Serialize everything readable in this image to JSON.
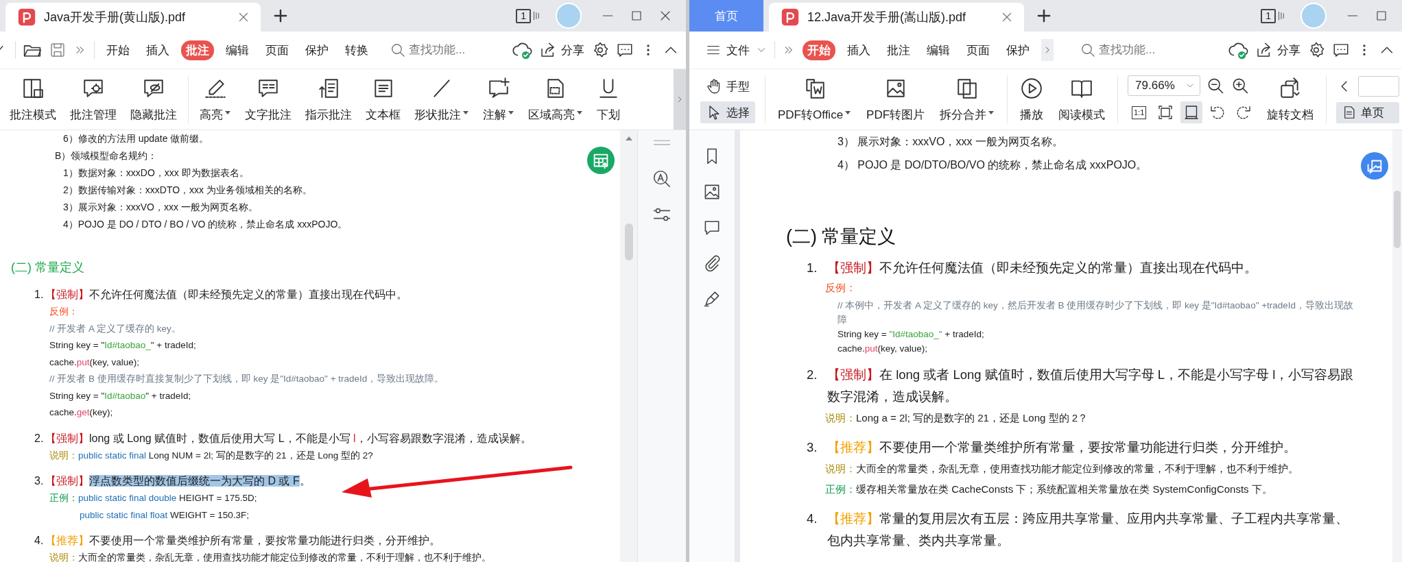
{
  "left_window": {
    "tab": {
      "title": "Java开发手册(黄山版).pdf",
      "selected": true
    },
    "tab_count": "1",
    "menu": {
      "tabs": [
        {
          "label": "开始",
          "selected": false
        },
        {
          "label": "插入",
          "selected": false
        },
        {
          "label": "批注",
          "selected": true
        },
        {
          "label": "编辑",
          "selected": false
        },
        {
          "label": "页面",
          "selected": false
        },
        {
          "label": "保护",
          "selected": false
        },
        {
          "label": "转换",
          "selected": false
        }
      ],
      "search": {
        "placeholder": "查找功能..."
      },
      "share": "分享"
    },
    "toolbar": [
      {
        "label": "批注模式",
        "dropdown": false
      },
      {
        "label": "批注管理",
        "dropdown": false
      },
      {
        "label": "隐藏批注",
        "dropdown": false
      },
      {
        "label": "高亮",
        "dropdown": true
      },
      {
        "label": "文字批注",
        "dropdown": false
      },
      {
        "label": "指示批注",
        "dropdown": false
      },
      {
        "label": "文本框",
        "dropdown": false
      },
      {
        "label": "形状批注",
        "dropdown": true
      },
      {
        "label": "注解",
        "dropdown": true
      },
      {
        "label": "区域高亮",
        "dropdown": true
      },
      {
        "label": "下划",
        "dropdown": false
      }
    ],
    "document": {
      "lines": [
        {
          "kind": "sub_item",
          "segments": [
            {
              "kind": "plain",
              "text": "6）修改的方法用 update 做前缀。"
            }
          ]
        },
        {
          "kind": "sub_heading",
          "segments": [
            {
              "kind": "plain",
              "text": "B）领域模型命名规约："
            }
          ]
        },
        {
          "kind": "sub_item",
          "segments": [
            {
              "kind": "plain",
              "text": "1）数据对象：xxxDO，xxx 即为数据表名。"
            }
          ]
        },
        {
          "kind": "sub_item",
          "segments": [
            {
              "kind": "plain",
              "text": "2）数据传输对象：xxxDTO，xxx 为业务领域相关的名称。"
            }
          ]
        },
        {
          "kind": "sub_item",
          "segments": [
            {
              "kind": "plain",
              "text": "3）展示对象：xxxVO，xxx 一般为网页名称。"
            }
          ]
        },
        {
          "kind": "sub_item",
          "segments": [
            {
              "kind": "plain",
              "text": "4）POJO 是 DO / DTO / BO / VO 的统称，禁止命名成 xxxPOJO。"
            }
          ]
        },
        {
          "kind": "heading",
          "segments": [
            {
              "kind": "plain",
              "text": "(二) 常量定义"
            }
          ]
        },
        {
          "kind": "item",
          "number": "1.",
          "segments": [
            {
              "kind": "mandatory",
              "text": "【强制】"
            },
            {
              "kind": "plain",
              "text": "不允许任何魔法值（即未经预先定义的常量）直接出现在代码中。"
            }
          ]
        },
        {
          "kind": "detail",
          "segments": [
            {
              "kind": "counter_label",
              "text": "反例："
            }
          ]
        },
        {
          "kind": "detail",
          "segments": [
            {
              "kind": "comment",
              "text": "//  开发者 A 定义了缓存的 key。"
            }
          ]
        },
        {
          "kind": "detail",
          "segments": [
            {
              "kind": "plain",
              "text": "String key = \""
            },
            {
              "kind": "string",
              "text": "Id#taobao_"
            },
            {
              "kind": "plain",
              "text": "\" + tradeId;"
            }
          ]
        },
        {
          "kind": "detail",
          "segments": [
            {
              "kind": "plain",
              "text": "cache."
            },
            {
              "kind": "method",
              "text": "put"
            },
            {
              "kind": "plain",
              "text": "(key, value);"
            }
          ]
        },
        {
          "kind": "detail",
          "segments": [
            {
              "kind": "comment",
              "text": "// 开发者 B 使用缓存时直接复制少了下划线，即 key 是\"Id#taobao\" + tradeId，导致出现故障。"
            }
          ]
        },
        {
          "kind": "detail",
          "segments": [
            {
              "kind": "plain",
              "text": "String key = \""
            },
            {
              "kind": "string",
              "text": "Id#taobao"
            },
            {
              "kind": "plain",
              "text": "\" + tradeId;"
            }
          ]
        },
        {
          "kind": "detail",
          "segments": [
            {
              "kind": "plain",
              "text": "cache."
            },
            {
              "kind": "method",
              "text": "get"
            },
            {
              "kind": "plain",
              "text": "(key);"
            }
          ]
        },
        {
          "kind": "item",
          "number": "2.",
          "segments": [
            {
              "kind": "mandatory",
              "text": "【强制】"
            },
            {
              "kind": "plain",
              "text": "long 或 Long 赋值时，数值后使用大写 L，不能是小写 "
            },
            {
              "kind": "alert",
              "text": "l"
            },
            {
              "kind": "plain",
              "text": "，小写容易跟数字混淆，造成误解。"
            }
          ]
        },
        {
          "kind": "detail",
          "segments": [
            {
              "kind": "note_label",
              "text": "说明："
            },
            {
              "kind": "keyword",
              "text": "public static final"
            },
            {
              "kind": "plain",
              "text": " Long NUM = 2l; 写的是数字的 21，还是 Long 型的 2?"
            }
          ]
        },
        {
          "kind": "item",
          "number": "3.",
          "segments": [
            {
              "kind": "mandatory",
              "text": "【强制】"
            },
            {
              "kind": "highlight",
              "text": "浮点数类型的数值后缀统一为大写的 D 或 F"
            },
            {
              "kind": "plain",
              "text": "。"
            }
          ]
        },
        {
          "kind": "detail",
          "segments": [
            {
              "kind": "example_label",
              "text": "正例："
            },
            {
              "kind": "keyword",
              "text": "public static final double"
            },
            {
              "kind": "plain",
              "text": " HEIGHT = 175.5D;"
            }
          ]
        },
        {
          "kind": "detail_indent",
          "segments": [
            {
              "kind": "keyword",
              "text": "public static final float"
            },
            {
              "kind": "plain",
              "text": " WEIGHT = 150.3F;"
            }
          ]
        },
        {
          "kind": "item",
          "number": "4.",
          "segments": [
            {
              "kind": "recommended",
              "text": "【推荐】"
            },
            {
              "kind": "plain",
              "text": "不要使用一个常量类维护所有常量，要按常量功能进行归类，分开维护。"
            }
          ]
        },
        {
          "kind": "detail",
          "segments": [
            {
              "kind": "note_label",
              "text": "说明："
            },
            {
              "kind": "plain",
              "text": "大而全的常量类，杂乱无章，使用查找功能才能定位到修改的常量，不利于理解，也不利于维护。"
            }
          ]
        }
      ]
    }
  },
  "right_window": {
    "home_tab": "首页",
    "tab": {
      "title": "12.Java开发手册(嵩山版).pdf",
      "selected": true
    },
    "tab_count": "1",
    "menu": {
      "file": "文件",
      "tabs": [
        {
          "label": "开始",
          "selected": true
        },
        {
          "label": "插入",
          "selected": false
        },
        {
          "label": "批注",
          "selected": false
        },
        {
          "label": "编辑",
          "selected": false
        },
        {
          "label": "页面",
          "selected": false
        },
        {
          "label": "保护",
          "selected": false
        }
      ],
      "search": {
        "placeholder": "查找功能..."
      },
      "share": "分享"
    },
    "toolbar": {
      "modes": [
        {
          "label": "手型",
          "selected": false
        },
        {
          "label": "选择",
          "selected": true
        }
      ],
      "tools": [
        {
          "label": "PDF转Office",
          "dropdown": true
        },
        {
          "label": "PDF转图片",
          "dropdown": false
        },
        {
          "label": "拆分合并",
          "dropdown": true
        },
        {
          "label": "播放",
          "dropdown": false
        },
        {
          "label": "阅读模式",
          "dropdown": false
        }
      ],
      "zoom": "79.66%",
      "fit_tools": [
        {
          "kind": "actual_size",
          "label": "1:1",
          "selected": false
        },
        {
          "kind": "fit_page",
          "selected": false
        },
        {
          "kind": "fit_width",
          "selected": true
        },
        {
          "kind": "rotate_left",
          "selected": false
        },
        {
          "kind": "rotate_right",
          "selected": false
        }
      ],
      "rotate": "旋转文档",
      "view_mode": {
        "label": "单页",
        "selected": true
      }
    },
    "document": {
      "lines": [
        {
          "kind": "sub_item",
          "segments": [
            {
              "kind": "plain",
              "text": "3） 展示对象：xxxVO，xxx 一般为网页名称。"
            }
          ]
        },
        {
          "kind": "sub_item",
          "segments": [
            {
              "kind": "plain",
              "text": "4） POJO 是 DO/DTO/BO/VO 的统称，禁止命名成 xxxPOJO。"
            }
          ]
        },
        {
          "kind": "heading",
          "segments": [
            {
              "kind": "plain",
              "text": "(二)  常量定义"
            }
          ]
        },
        {
          "kind": "item",
          "number": "1.",
          "segments": [
            {
              "kind": "mandatory",
              "text": "【强制】"
            },
            {
              "kind": "plain",
              "text": "不允许任何魔法值（即未经预先定义的常量）直接出现在代码中。"
            }
          ]
        },
        {
          "kind": "detail",
          "segments": [
            {
              "kind": "counter_label",
              "text": "反例："
            }
          ]
        },
        {
          "kind": "code",
          "segments": [
            {
              "kind": "comment",
              "text": "//  本例中，开发者 A 定义了缓存的 key，然后开发者 B 使用缓存时少了下划线，即 key 是\"Id#taobao\" +tradeId，导致出现故障"
            }
          ]
        },
        {
          "kind": "code",
          "segments": [
            {
              "kind": "plain",
              "text": "String key = "
            },
            {
              "kind": "string",
              "text": "\"Id#taobao_\""
            },
            {
              "kind": "plain",
              "text": " + tradeId;"
            }
          ]
        },
        {
          "kind": "code",
          "segments": [
            {
              "kind": "plain",
              "text": "cache."
            },
            {
              "kind": "method",
              "text": "put"
            },
            {
              "kind": "plain",
              "text": "(key, value);"
            }
          ]
        },
        {
          "kind": "item",
          "number": "2.",
          "segments": [
            {
              "kind": "mandatory",
              "text": "【强制】"
            },
            {
              "kind": "plain",
              "text": "在 long 或者 Long 赋值时，数值后使用大写字母 L，不能是小写字母 l，小写容易跟数字混淆，造成误解。"
            }
          ]
        },
        {
          "kind": "detail",
          "segments": [
            {
              "kind": "note_label",
              "text": "说明："
            },
            {
              "kind": "plain",
              "text": "Long a = 2l; 写的是数字的 21，还是 Long 型的 2？"
            }
          ]
        },
        {
          "kind": "item",
          "number": "3.",
          "segments": [
            {
              "kind": "recommended",
              "text": "【推荐】"
            },
            {
              "kind": "plain",
              "text": "不要使用一个常量类维护所有常量，要按常量功能进行归类，分开维护。"
            }
          ]
        },
        {
          "kind": "detail",
          "segments": [
            {
              "kind": "note_label",
              "text": "说明："
            },
            {
              "kind": "plain",
              "text": "大而全的常量类，杂乱无章，使用查找功能才能定位到修改的常量，不利于理解，也不利于维护。"
            }
          ]
        },
        {
          "kind": "detail",
          "segments": [
            {
              "kind": "example_label",
              "text": "正例："
            },
            {
              "kind": "plain",
              "text": "缓存相关常量放在类 CacheConsts 下；系统配置相关常量放在类 SystemConfigConsts 下。"
            }
          ]
        },
        {
          "kind": "item",
          "number": "4.",
          "segments": [
            {
              "kind": "recommended",
              "text": "【推荐】"
            },
            {
              "kind": "plain",
              "text": "常量的复用层次有五层：跨应用共享常量、应用内共享常量、子工程内共享常量、包内共享常量、类内共享常量。"
            }
          ]
        }
      ]
    }
  }
}
